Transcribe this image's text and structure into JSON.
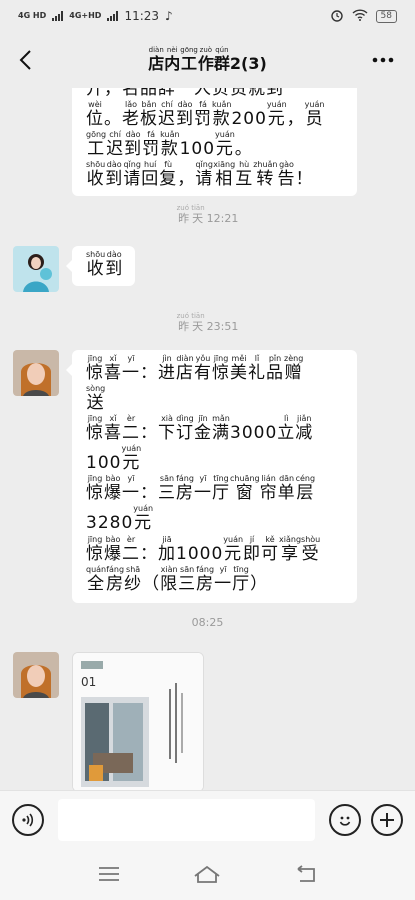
{
  "status_bar": {
    "signal1": "4G HD",
    "signal2": "4G+HD",
    "time": "11:23",
    "battery": "58"
  },
  "header": {
    "title_chars": [
      {
        "c": "店",
        "p": "diàn"
      },
      {
        "c": "内",
        "p": "nèi"
      },
      {
        "c": "工",
        "p": "gōng"
      },
      {
        "c": "作",
        "p": "zuò"
      },
      {
        "c": "群",
        "p": "qún"
      }
    ],
    "member_count": "2(3)"
  },
  "messages": {
    "m1_lines": [
      [
        {
          "c": "开",
          "p": ""
        },
        {
          "c": "，",
          "p": ""
        },
        {
          "c": "名",
          "p": ""
        },
        {
          "c": "品",
          "p": ""
        },
        {
          "c": "辞",
          "p": ""
        },
        {
          "c": "一",
          "p": ""
        },
        {
          "c": "人",
          "p": ""
        },
        {
          "c": "负",
          "p": ""
        },
        {
          "c": "责",
          "p": ""
        },
        {
          "c": "就",
          "p": ""
        },
        {
          "c": "到",
          "p": ""
        }
      ],
      [
        {
          "c": "位",
          "p": "wèi"
        },
        {
          "c": "。",
          "p": ""
        },
        {
          "c": "老",
          "p": "lǎo"
        },
        {
          "c": "板",
          "p": "bǎn"
        },
        {
          "c": "迟",
          "p": "chí"
        },
        {
          "c": "到",
          "p": "dào"
        },
        {
          "c": "罚",
          "p": "fá"
        },
        {
          "c": "款",
          "p": "kuǎn"
        },
        {
          "c": "200",
          "p": ""
        },
        {
          "c": "元",
          "p": "yuán"
        },
        {
          "c": "，",
          "p": ""
        },
        {
          "c": "员",
          "p": "yuán"
        }
      ],
      [
        {
          "c": "工",
          "p": "gōng"
        },
        {
          "c": "迟",
          "p": "chí"
        },
        {
          "c": "到",
          "p": "dào"
        },
        {
          "c": "罚",
          "p": "fá"
        },
        {
          "c": "款",
          "p": "kuǎn"
        },
        {
          "c": "100",
          "p": ""
        },
        {
          "c": "元",
          "p": "yuán"
        },
        {
          "c": "。",
          "p": ""
        }
      ],
      [
        {
          "c": "收",
          "p": "shōu"
        },
        {
          "c": "到",
          "p": "dào"
        },
        {
          "c": "请",
          "p": "qǐng"
        },
        {
          "c": "回",
          "p": "huí"
        },
        {
          "c": "复",
          "p": "fù"
        },
        {
          "c": "，",
          "p": ""
        },
        {
          "c": "请",
          "p": "qǐng"
        },
        {
          "c": "相",
          "p": "xiāng"
        },
        {
          "c": "互",
          "p": "hù"
        },
        {
          "c": "转",
          "p": "zhuǎn"
        },
        {
          "c": "告",
          "p": "gào"
        },
        {
          "c": "！",
          "p": ""
        }
      ]
    ],
    "time1": {
      "text": "昨天",
      "pinyin": "zuó tiān",
      "clock": "12:21"
    },
    "m2_chars": [
      {
        "c": "收",
        "p": "shōu"
      },
      {
        "c": "到",
        "p": "dào"
      }
    ],
    "time2": {
      "text": "昨天",
      "pinyin": "zuó tiān",
      "clock": "23:51"
    },
    "m3_lines": [
      [
        {
          "c": "惊",
          "p": "jīng"
        },
        {
          "c": "喜",
          "p": "xǐ"
        },
        {
          "c": "一",
          "p": "yī"
        },
        {
          "c": "：",
          "p": ""
        },
        {
          "c": "进",
          "p": "jìn"
        },
        {
          "c": "店",
          "p": "diàn"
        },
        {
          "c": "有",
          "p": "yǒu"
        },
        {
          "c": "惊",
          "p": "jīng"
        },
        {
          "c": "美",
          "p": "měi"
        },
        {
          "c": "礼",
          "p": "lǐ"
        },
        {
          "c": "品",
          "p": "pǐn"
        },
        {
          "c": "赠",
          "p": "zèng"
        }
      ],
      [
        {
          "c": "送",
          "p": "sòng"
        }
      ],
      [
        {
          "c": "惊",
          "p": "jīng"
        },
        {
          "c": "喜",
          "p": "xǐ"
        },
        {
          "c": "二",
          "p": "èr"
        },
        {
          "c": "：",
          "p": ""
        },
        {
          "c": "下",
          "p": "xià"
        },
        {
          "c": "订",
          "p": "dìng"
        },
        {
          "c": "金",
          "p": "jīn"
        },
        {
          "c": "满",
          "p": "mǎn"
        },
        {
          "c": "3000",
          "p": ""
        },
        {
          "c": "立",
          "p": "lì"
        },
        {
          "c": "减",
          "p": "jiǎn"
        }
      ],
      [
        {
          "c": "100",
          "p": ""
        },
        {
          "c": "元",
          "p": "yuán"
        }
      ],
      [
        {
          "c": "惊",
          "p": "jīng"
        },
        {
          "c": "爆",
          "p": "bào"
        },
        {
          "c": "一",
          "p": "yī"
        },
        {
          "c": "：",
          "p": ""
        },
        {
          "c": "三",
          "p": "sān"
        },
        {
          "c": "房",
          "p": "fáng"
        },
        {
          "c": "一",
          "p": "yī"
        },
        {
          "c": "厅",
          "p": "tīng"
        },
        {
          "c": "窗",
          "p": "chuāng"
        },
        {
          "c": "帘",
          "p": "lián"
        },
        {
          "c": "单",
          "p": "dān"
        },
        {
          "c": "层",
          "p": "céng"
        }
      ],
      [
        {
          "c": "3280",
          "p": ""
        },
        {
          "c": "元",
          "p": "yuán"
        }
      ],
      [
        {
          "c": "惊",
          "p": "jīng"
        },
        {
          "c": "爆",
          "p": "bào"
        },
        {
          "c": "二",
          "p": "èr"
        },
        {
          "c": "：",
          "p": ""
        },
        {
          "c": "加",
          "p": "jiā"
        },
        {
          "c": "1000",
          "p": ""
        },
        {
          "c": "元",
          "p": "yuán"
        },
        {
          "c": "即",
          "p": "jí"
        },
        {
          "c": "可",
          "p": "kě"
        },
        {
          "c": "享",
          "p": "xiǎng"
        },
        {
          "c": "受",
          "p": "shòu"
        }
      ],
      [
        {
          "c": "全",
          "p": "quán"
        },
        {
          "c": "房",
          "p": "fáng"
        },
        {
          "c": "纱",
          "p": "shā"
        },
        {
          "c": "（",
          "p": ""
        },
        {
          "c": "限",
          "p": "xiàn"
        },
        {
          "c": "三",
          "p": "sān"
        },
        {
          "c": "房",
          "p": "fáng"
        },
        {
          "c": "一",
          "p": "yī"
        },
        {
          "c": "厅",
          "p": "tīng"
        },
        {
          "c": "）",
          "p": ""
        }
      ]
    ],
    "time3": "08:25",
    "doc_page_number": "01"
  },
  "colors": {
    "bg": "#ededed",
    "bubble": "#ffffff",
    "time_text": "#9a9a9a"
  }
}
